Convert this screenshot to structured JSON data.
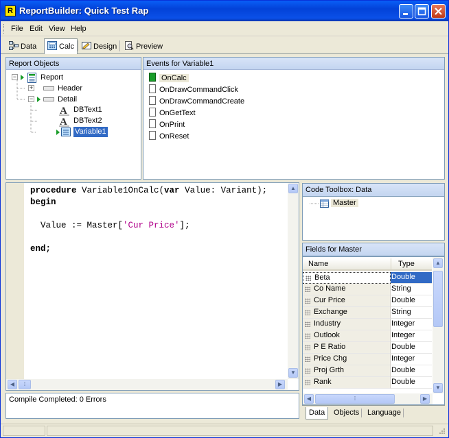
{
  "window": {
    "title": "ReportBuilder: Quick Test Rap",
    "app_icon_letter": "R"
  },
  "menu": [
    "File",
    "Edit",
    "View",
    "Help"
  ],
  "tabs": [
    {
      "label": "Data",
      "active": false
    },
    {
      "label": "Calc",
      "active": true
    },
    {
      "label": "Design",
      "active": false
    },
    {
      "label": "Preview",
      "active": false
    }
  ],
  "report_objects": {
    "header": "Report Objects",
    "items": [
      "Report",
      "Header",
      "Detail",
      "DBText1",
      "DBText2",
      "Variable1"
    ],
    "selected": "Variable1"
  },
  "events": {
    "header": "Events for Variable1",
    "items": [
      "OnCalc",
      "OnDrawCommandClick",
      "OnDrawCommandCreate",
      "OnGetText",
      "OnPrint",
      "OnReset"
    ],
    "selected": "OnCalc"
  },
  "code": {
    "line1_kw1": "procedure",
    "line1_rest1": " Variable1OnCalc(",
    "line1_kw2": "var",
    "line1_rest2": " Value: Variant);",
    "line2_kw": "begin",
    "line4_pre": "  Value := Master[",
    "line4_str": "'Cur Price'",
    "line4_post": "];",
    "line6_kw": "end;"
  },
  "compile_message": "Compile Completed: 0 Errors",
  "code_toolbox": {
    "header": "Code Toolbox: Data",
    "item": "Master"
  },
  "fields": {
    "header": "Fields for Master",
    "col_name": "Name",
    "col_type": "Type",
    "rows": [
      {
        "name": "Beta",
        "type": "Double"
      },
      {
        "name": "Co Name",
        "type": "String"
      },
      {
        "name": "Cur Price",
        "type": "Double"
      },
      {
        "name": "Exchange",
        "type": "String"
      },
      {
        "name": "Industry",
        "type": "Integer"
      },
      {
        "name": "Outlook",
        "type": "Integer"
      },
      {
        "name": "P E Ratio",
        "type": "Double"
      },
      {
        "name": "Price Chg",
        "type": "Integer"
      },
      {
        "name": "Proj Grth",
        "type": "Double"
      },
      {
        "name": "Rank",
        "type": "Double"
      }
    ],
    "selected": "Beta"
  },
  "toolbox_tabs": [
    {
      "label": "Data",
      "active": true
    },
    {
      "label": "Objects",
      "active": false
    },
    {
      "label": "Language",
      "active": false
    }
  ],
  "colors": {
    "selection": "#316ac5",
    "title_blue": "#0a5ef6",
    "string_literal": "#b0008a"
  }
}
